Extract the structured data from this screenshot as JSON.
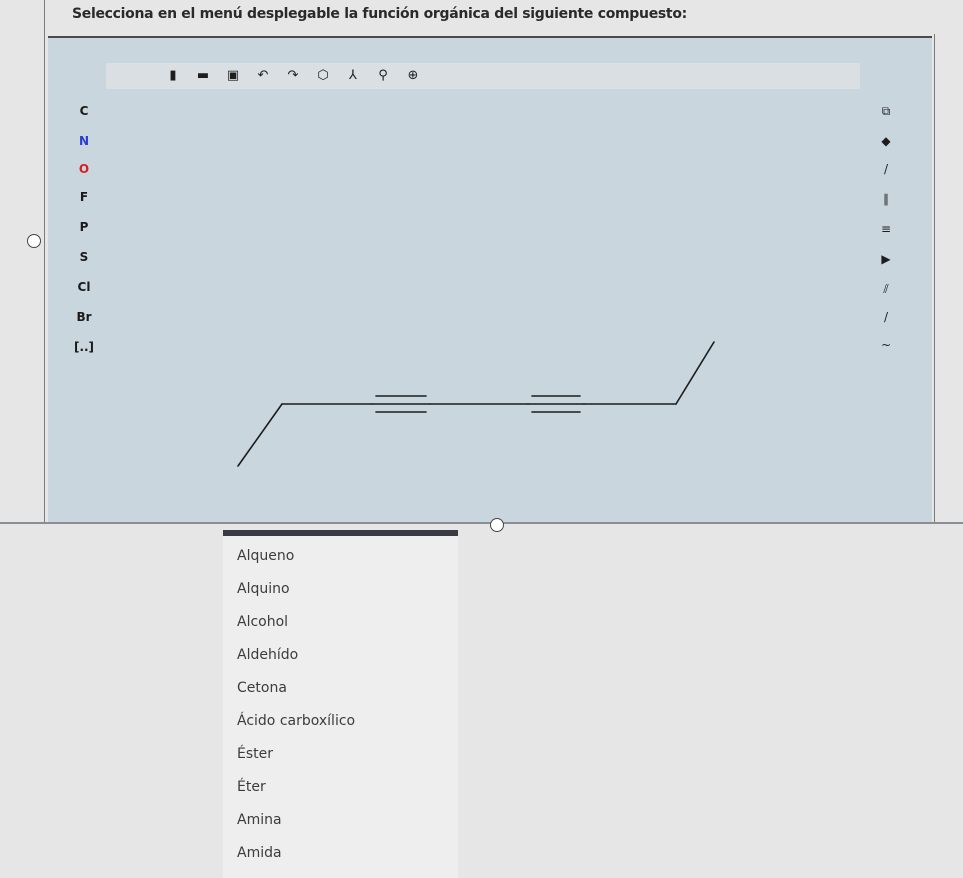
{
  "question": "Selecciona en el menú desplegable la función orgánica del siguiente compuesto:",
  "toolbar": {
    "icons": [
      "new-file-icon",
      "open-icon",
      "save-icon",
      "undo-icon",
      "redo-icon",
      "ring-icon",
      "chain-icon",
      "zoom-icon",
      "info-icon"
    ],
    "glyphs": [
      "▮",
      "▬",
      "▣",
      "↶",
      "↷",
      "⬡",
      "⅄",
      "⚲",
      "⊕"
    ]
  },
  "elements": [
    {
      "label": "C",
      "color": "#1a1a1a"
    },
    {
      "label": "N",
      "color": "#2b3bd6"
    },
    {
      "label": "O",
      "color": "#d61f1f"
    },
    {
      "label": "F",
      "color": "#1a1a1a"
    },
    {
      "label": "P",
      "color": "#1a1a1a"
    },
    {
      "label": "S",
      "color": "#1a1a1a"
    },
    {
      "label": "Cl",
      "color": "#1a1a1a"
    },
    {
      "label": "Br",
      "color": "#1a1a1a"
    },
    {
      "label": "[..]",
      "color": "#1a1a1a"
    }
  ],
  "right_tools": {
    "icons": [
      "select-tool-icon",
      "eraser-icon",
      "single-bond-icon",
      "double-bond-icon",
      "triple-bond-icon",
      "wedge-bond-icon",
      "hash-bond-icon",
      "chain-draw-icon",
      "arc-icon"
    ],
    "glyphs": [
      "⧉",
      "◆",
      "/",
      "∥",
      "≡",
      "▶",
      "⫽",
      "/",
      "~"
    ]
  },
  "dropdown": {
    "options": [
      "Alqueno",
      "Alquino",
      "Alcohol",
      "Aldehído",
      "Cetona",
      "Ácido carboxílico",
      "Éster",
      "Éter",
      "Amina",
      "Amida"
    ]
  }
}
